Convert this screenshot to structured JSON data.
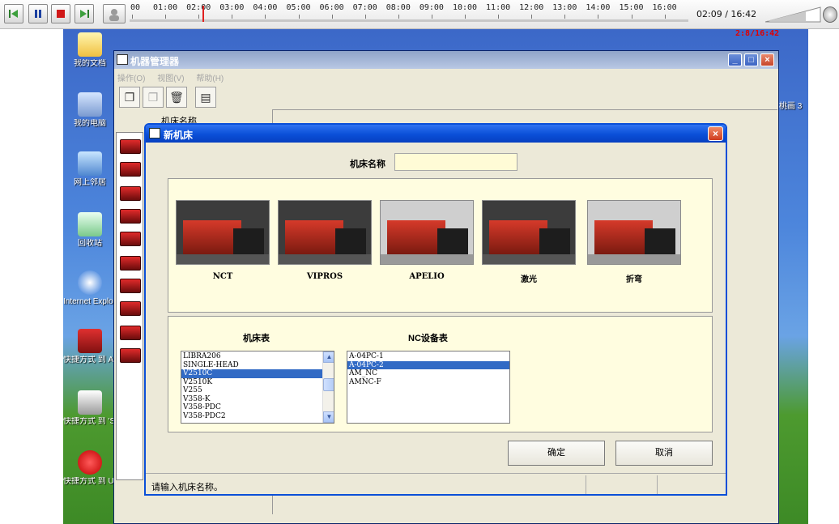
{
  "player": {
    "timeline_labels": [
      "00",
      "01:00",
      "02:00",
      "03:00",
      "04:00",
      "05:00",
      "06:00",
      "07:00",
      "08:00",
      "09:00",
      "10:00",
      "11:00",
      "12:00",
      "13:00",
      "14:00",
      "15:00",
      "16:00"
    ],
    "current_time": "02:09 / 16:42",
    "progress": 0.13,
    "overlay_time": "2:8/16:42"
  },
  "desktop": {
    "icons": [
      "我的文档",
      "我的电脑",
      "网上邻居",
      "回收站",
      "Internet Explorer",
      "快捷方式 到 AP100 主菜单",
      "快捷方式 到 'Server'...",
      "快捷方式 到 Unlock"
    ],
    "partial_right": "桃画 3"
  },
  "main_window": {
    "title": "机器管理器",
    "menu": [
      "操作(O)",
      "视图(V)",
      "帮助(H)"
    ],
    "column_header": "机床名称"
  },
  "dialog": {
    "title": "新机床",
    "name_label": "机床名称",
    "name_value": "",
    "machine_types": [
      "NCT",
      "VIPROS",
      "APELIO",
      "激光",
      "折弯"
    ],
    "machine_table_label": "机床表",
    "nc_table_label": "NC设备表",
    "machine_table_items": [
      "LIBRA206",
      "SINGLE-HEAD",
      "V2510C",
      "V2510K",
      "V255",
      "V358-K",
      "V358-PDC",
      "V358-PDC2"
    ],
    "machine_table_selected": 2,
    "nc_table_items": [
      "A-04PC-1",
      "A-04PC-2",
      "AM_NC",
      "AMNC-F"
    ],
    "nc_table_selected": 1,
    "ok_label": "确定",
    "cancel_label": "取消",
    "status_text": "请输入机床名称。"
  },
  "colors": {
    "dialog_titlebar": "#0a4fd8",
    "selection": "#316ac5",
    "panel_background": "#fffde0",
    "input_background": "#fffbd6",
    "playhead": "#e02020"
  }
}
